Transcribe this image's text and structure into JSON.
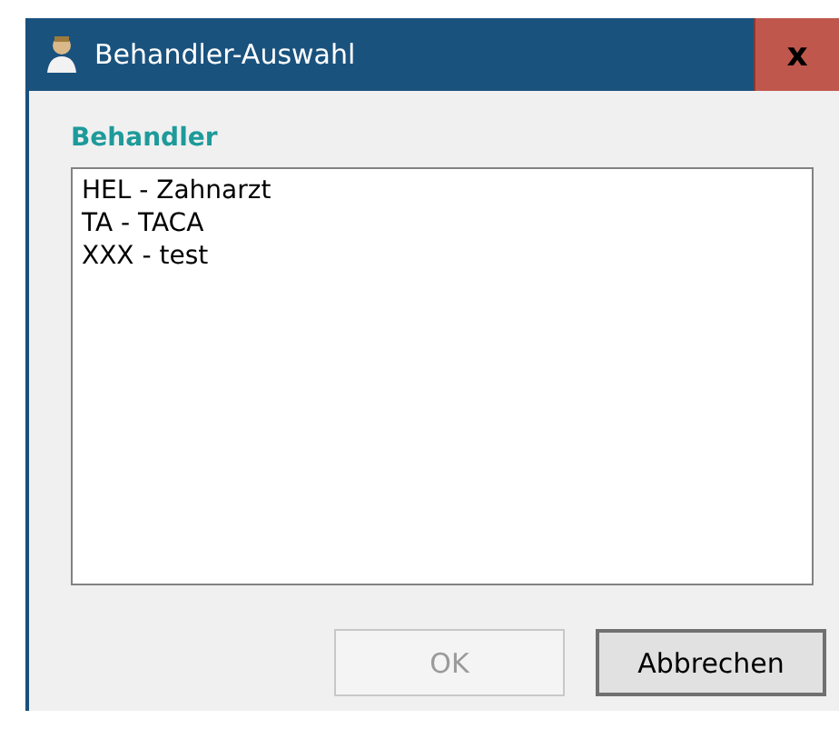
{
  "window": {
    "title": "Behandler-Auswahl",
    "close": "x"
  },
  "group_label": "Behandler",
  "list": [
    {
      "label": "HEL - Zahnarzt"
    },
    {
      "label": "TA - TACA"
    },
    {
      "label": "XXX - test"
    }
  ],
  "buttons": [
    {
      "label": "OK",
      "disabled": true
    },
    {
      "label": "Abbrechen",
      "disabled": false
    }
  ]
}
